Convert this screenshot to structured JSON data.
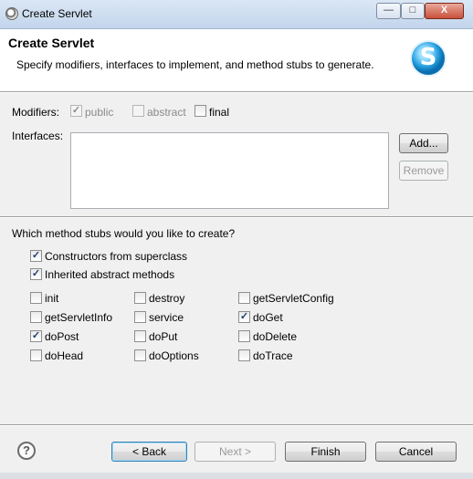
{
  "window": {
    "title": "Create Servlet",
    "controls": {
      "minimize": "—",
      "maximize": "□",
      "close": "X"
    }
  },
  "header": {
    "title": "Create Servlet",
    "description": "Specify modifiers, interfaces to implement, and method stubs to generate.",
    "logo_letter": "S"
  },
  "modifiers": {
    "label": "Modifiers:",
    "options": [
      {
        "label": "public",
        "checked": true,
        "enabled": false
      },
      {
        "label": "abstract",
        "checked": false,
        "enabled": false
      },
      {
        "label": "final",
        "checked": false,
        "enabled": true
      }
    ]
  },
  "interfaces": {
    "label": "Interfaces:",
    "items": [],
    "add_label": "Add...",
    "remove_label": "Remove"
  },
  "stubs": {
    "question": "Which method stubs would you like to create?",
    "general": [
      {
        "label": "Constructors from superclass",
        "checked": true
      },
      {
        "label": "Inherited abstract methods",
        "checked": true
      }
    ],
    "methods": [
      {
        "label": "init",
        "checked": false
      },
      {
        "label": "destroy",
        "checked": false
      },
      {
        "label": "getServletConfig",
        "checked": false
      },
      {
        "label": "getServletInfo",
        "checked": false
      },
      {
        "label": "service",
        "checked": false
      },
      {
        "label": "doGet",
        "checked": true
      },
      {
        "label": "doPost",
        "checked": true
      },
      {
        "label": "doPut",
        "checked": false
      },
      {
        "label": "doDelete",
        "checked": false
      },
      {
        "label": "doHead",
        "checked": false
      },
      {
        "label": "doOptions",
        "checked": false
      },
      {
        "label": "doTrace",
        "checked": false
      }
    ]
  },
  "footer": {
    "help_symbol": "?",
    "back_label": "< Back",
    "next_label": "Next >",
    "finish_label": "Finish",
    "cancel_label": "Cancel"
  }
}
